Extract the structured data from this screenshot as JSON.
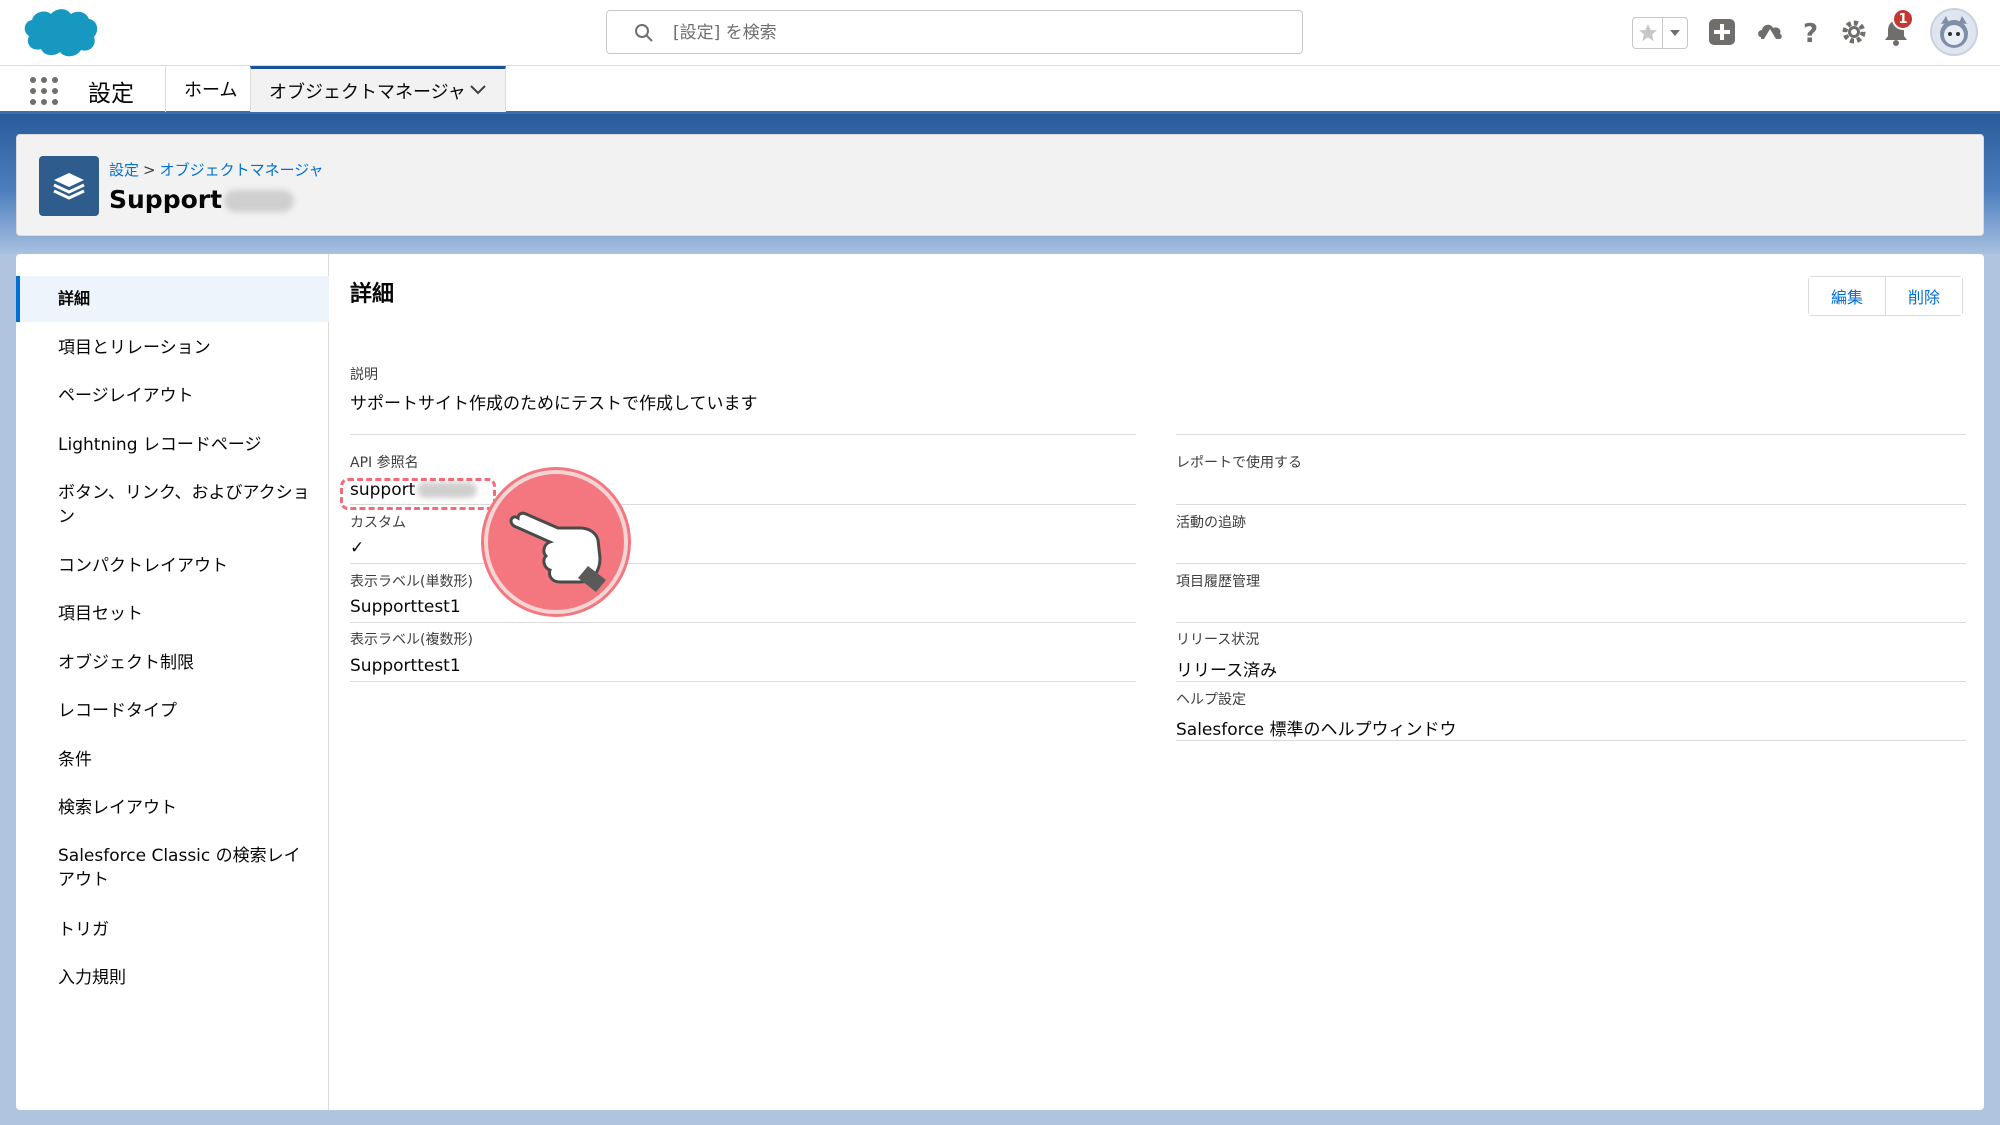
{
  "header": {
    "search": {
      "placeholder": "[設定] を検索"
    },
    "notifications": {
      "count": "1"
    }
  },
  "nav": {
    "app_name": "設定",
    "tabs": [
      {
        "label": "ホーム"
      },
      {
        "label": "オブジェクトマネージャ"
      }
    ]
  },
  "page_header": {
    "breadcrumb": [
      "設定",
      "オブジェクトマネージャ"
    ],
    "breadcrumb_sep": ">",
    "title": "Support"
  },
  "sidebar": {
    "items": [
      {
        "label": "詳細"
      },
      {
        "label": "項目とリレーション"
      },
      {
        "label": "ページレイアウト"
      },
      {
        "label": "Lightning レコードページ"
      },
      {
        "label": "ボタン、リンク、およびアクション"
      },
      {
        "label": "コンパクトレイアウト"
      },
      {
        "label": "項目セット"
      },
      {
        "label": "オブジェクト制限"
      },
      {
        "label": "レコードタイプ"
      },
      {
        "label": "条件"
      },
      {
        "label": "検索レイアウト"
      },
      {
        "label": "Salesforce Classic の検索レイアウト"
      },
      {
        "label": "トリガ"
      },
      {
        "label": "入力規則"
      }
    ]
  },
  "detail": {
    "title": "詳細",
    "buttons": {
      "edit": "編集",
      "delete": "削除"
    },
    "description": {
      "label": "説明",
      "value": "サポートサイト作成のためにテストで作成しています"
    },
    "left_fields": [
      {
        "label": "API 参照名",
        "value": "support"
      },
      {
        "label": "カスタム",
        "value": "✓"
      },
      {
        "label": "表示ラベル(単数形)",
        "value": "Supporttest1"
      },
      {
        "label": "表示ラベル(複数形)",
        "value": "Supporttest1"
      }
    ],
    "right_fields": [
      {
        "label": "レポートで使用する",
        "value": ""
      },
      {
        "label": "活動の追跡",
        "value": ""
      },
      {
        "label": "項目履歴管理",
        "value": ""
      },
      {
        "label": "リリース状況",
        "value": "リリース済み"
      },
      {
        "label": "ヘルプ設定",
        "value": "Salesforce 標準のヘルプウィンドウ"
      }
    ]
  },
  "colors": {
    "brand_blue": "#0070d2",
    "banner": "#2a5c9c",
    "highlight": "#f06c7a",
    "badge": "#c23934"
  },
  "icons": [
    "salesforce-logo",
    "search-icon",
    "star-icon",
    "chevron-down-icon",
    "add-icon",
    "trailhead-icon",
    "help-icon",
    "gear-icon",
    "bell-icon",
    "app-launcher-icon",
    "stack-icon",
    "check-icon",
    "pointing-hand-icon"
  ]
}
